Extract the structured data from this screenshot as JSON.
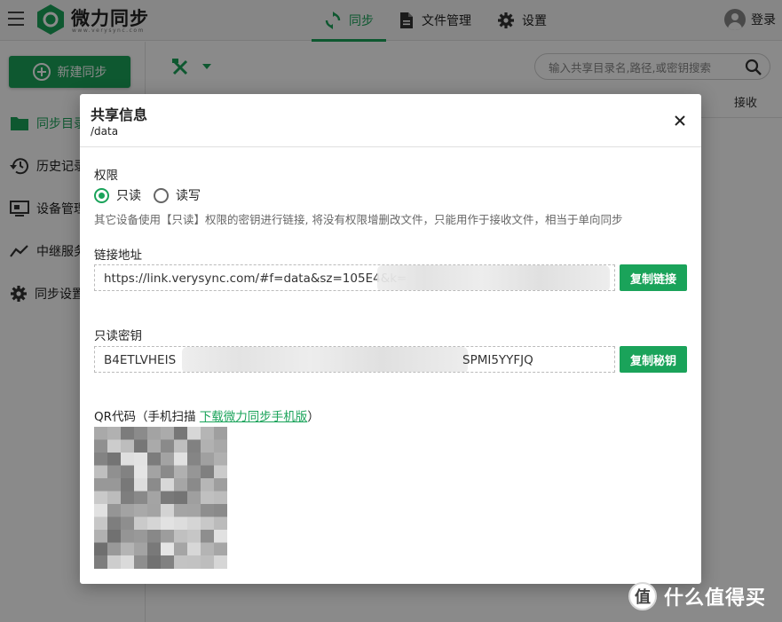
{
  "app": {
    "brand": "微力同步",
    "brand_sub": "www.verysync.com"
  },
  "nav": {
    "tabs": [
      {
        "label": "同步",
        "active": true
      },
      {
        "label": "文件管理",
        "active": false
      },
      {
        "label": "设置",
        "active": false
      }
    ],
    "login": "登录"
  },
  "sidebar": {
    "new_button": "新建同步",
    "items": [
      {
        "label": "同步目录",
        "icon": "folder-icon",
        "active": true
      },
      {
        "label": "历史记录",
        "icon": "history-icon",
        "active": false
      },
      {
        "label": "设备管理",
        "icon": "device-icon",
        "active": false
      },
      {
        "label": "中继服务",
        "icon": "relay-icon",
        "active": false
      },
      {
        "label": "同步设置",
        "icon": "gear-icon",
        "active": false
      }
    ]
  },
  "toolbar": {
    "search_placeholder": "输入共享目录名,路径,或密钥搜索"
  },
  "table": {
    "receive_header": "接收"
  },
  "modal": {
    "title": "共享信息",
    "path": "/data",
    "permission_label": "权限",
    "options": [
      {
        "label": "只读",
        "checked": true
      },
      {
        "label": "读写",
        "checked": false
      }
    ],
    "hint": "其它设备使用【只读】权限的密钥进行链接, 将没有权限增删改文件，只能用作于接收文件，相当于单向同步",
    "link_label": "链接地址",
    "link_value": "https://link.verysync.com/#f=data&sz=105E4&k=",
    "copy_link": "复制链接",
    "key_label": "只读密钥",
    "key_value_start": "B4ETLVHEIS",
    "key_value_end": "SPMI5YYFJQ",
    "copy_key": "复制秘钥",
    "qr_label_prefix": "QR代码（手机扫描 ",
    "qr_link": "下载微力同步手机版",
    "qr_label_suffix": "）"
  },
  "watermark": {
    "badge": "值",
    "text": "什么值得买"
  },
  "colors": {
    "accent": "#1aa35a",
    "overlay": "rgba(0,0,0,0.46)"
  }
}
